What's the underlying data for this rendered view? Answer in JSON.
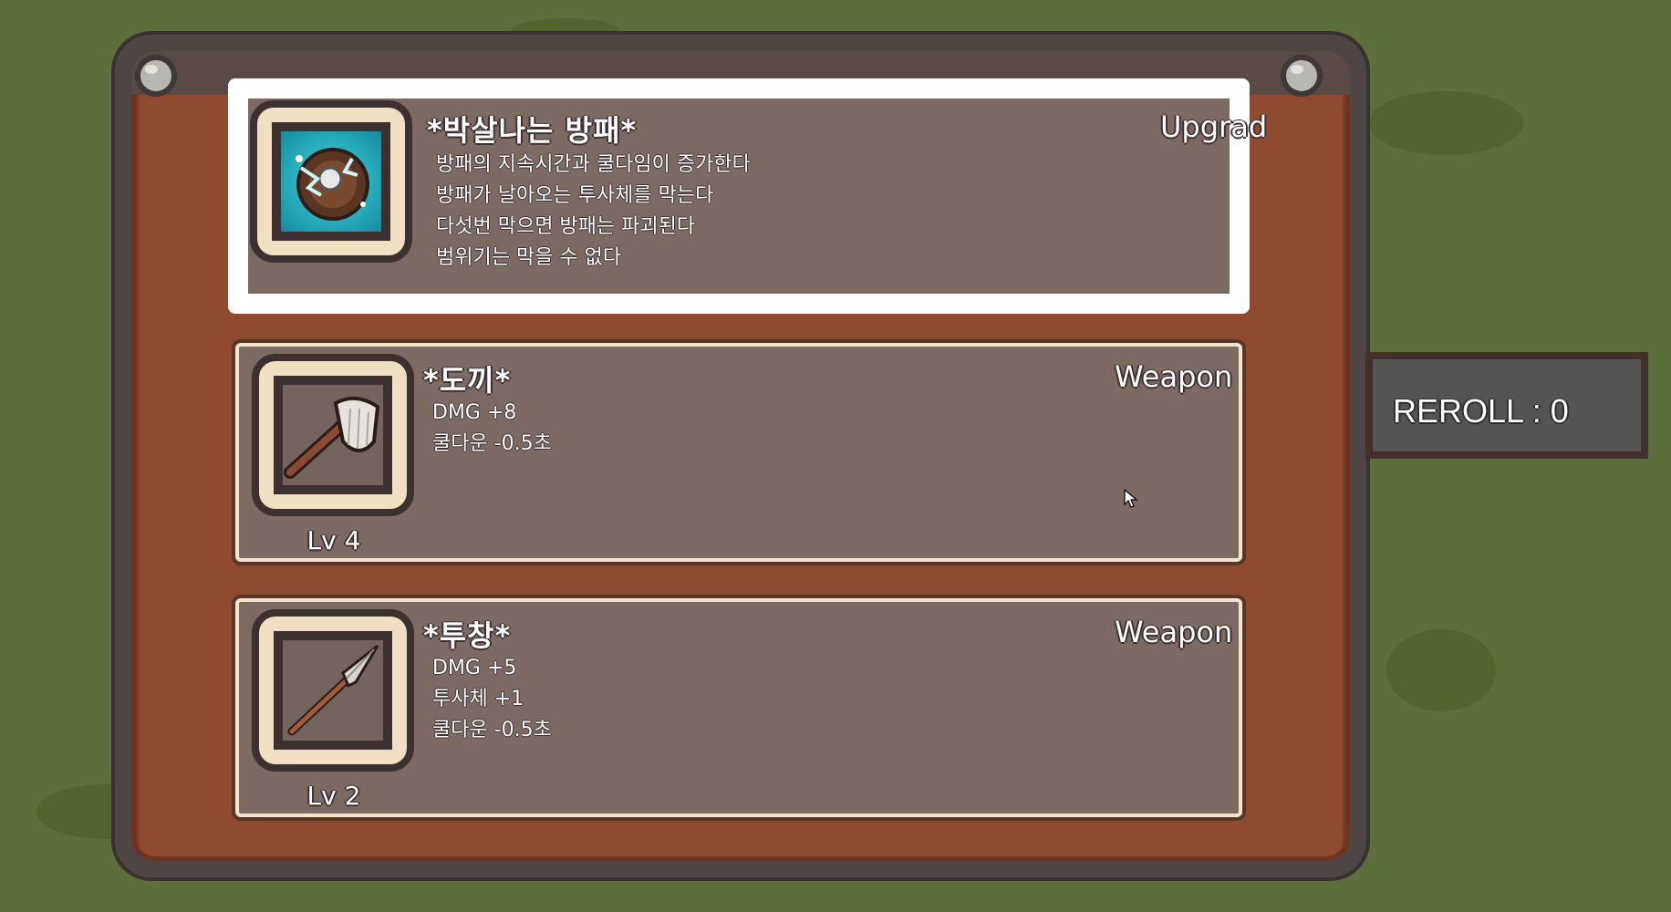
{
  "cards": [
    {
      "title": "*박살나는 방패*",
      "type": "Upgrad",
      "lines": [
        "방패의 지속시간과 쿨다임이 증가한다",
        "방패가 날아오는 투사체를 막는다",
        "다섯번 막으면 방패는 파괴된다",
        "범위기는 막을 수 없다"
      ],
      "icon": "cracked-shield-icon",
      "selected": true
    },
    {
      "title": "*도끼*",
      "type": "Weapon",
      "lines": [
        "DMG  +8",
        "쿨다운  -0.5초"
      ],
      "level": "Lv 4",
      "icon": "axe-icon"
    },
    {
      "title": "*투창*",
      "type": "Weapon",
      "lines": [
        "DMG  +5",
        "투사체  +1",
        "쿨다운  -0.5초"
      ],
      "level": "Lv 2",
      "icon": "spear-icon"
    }
  ],
  "reroll": {
    "label": "REROLL : 0"
  },
  "colors": {
    "background": "#5c6e3a",
    "board": "#8f4a2f",
    "card": "#7d6a63",
    "selected_border": "#ffffff"
  }
}
